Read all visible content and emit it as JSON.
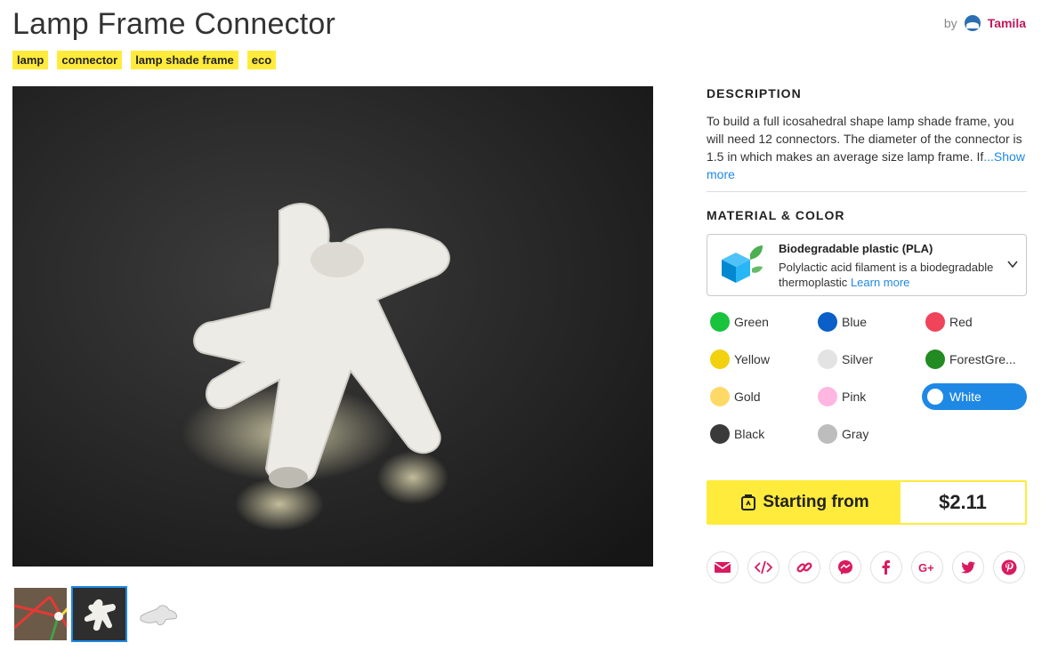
{
  "product": {
    "title": "Lamp Frame Connector",
    "by_label": "by",
    "author": "Tamila"
  },
  "tags": [
    "lamp",
    "connector",
    "lamp shade frame",
    "eco"
  ],
  "gallery": {
    "thumbnails": [
      {
        "name": "thumb-frame-assembly",
        "active": false
      },
      {
        "name": "thumb-connector-photo",
        "active": true
      },
      {
        "name": "thumb-connector-render",
        "active": false
      }
    ]
  },
  "description": {
    "heading": "DESCRIPTION",
    "text": "To build a full icosahedral shape lamp shade frame, you will need 12 connectors. The diameter of the connector is 1.5 in which makes an average size lamp frame. If",
    "show_more": "...Show more"
  },
  "material": {
    "heading": "MATERIAL & COLOR",
    "name": "Biodegradable plastic (PLA)",
    "description": "Polylactic acid filament is a biodegradable thermoplastic",
    "learn_more": "Learn more"
  },
  "colors": [
    {
      "label": "Green",
      "hex": "#19c33c",
      "selected": false
    },
    {
      "label": "Blue",
      "hex": "#0a5fc8",
      "selected": false
    },
    {
      "label": "Red",
      "hex": "#f0445a",
      "selected": false
    },
    {
      "label": "Yellow",
      "hex": "#f2d10e",
      "selected": false
    },
    {
      "label": "Silver",
      "hex": "#e3e3e3",
      "selected": false
    },
    {
      "label": "ForestGre...",
      "hex": "#228b22",
      "selected": false
    },
    {
      "label": "Gold",
      "hex": "#ffd966",
      "selected": false
    },
    {
      "label": "Pink",
      "hex": "#ffb6e1",
      "selected": false
    },
    {
      "label": "White",
      "hex": "#ffffff",
      "selected": true
    },
    {
      "label": "Black",
      "hex": "#3a3a3a",
      "selected": false
    },
    {
      "label": "Gray",
      "hex": "#bdbdbd",
      "selected": false
    }
  ],
  "purchase": {
    "start_label": "Starting from",
    "price": "$2.11"
  },
  "share": [
    {
      "name": "email-icon"
    },
    {
      "name": "embed-code-icon"
    },
    {
      "name": "link-icon"
    },
    {
      "name": "messenger-icon"
    },
    {
      "name": "facebook-icon"
    },
    {
      "name": "google-plus-icon"
    },
    {
      "name": "twitter-icon"
    },
    {
      "name": "pinterest-icon"
    }
  ],
  "theme": {
    "tag_yellow": "#ffeb3b",
    "accent_blue": "#1e88e5",
    "share_pink": "#d81b60",
    "author_color": "#c2185b"
  }
}
